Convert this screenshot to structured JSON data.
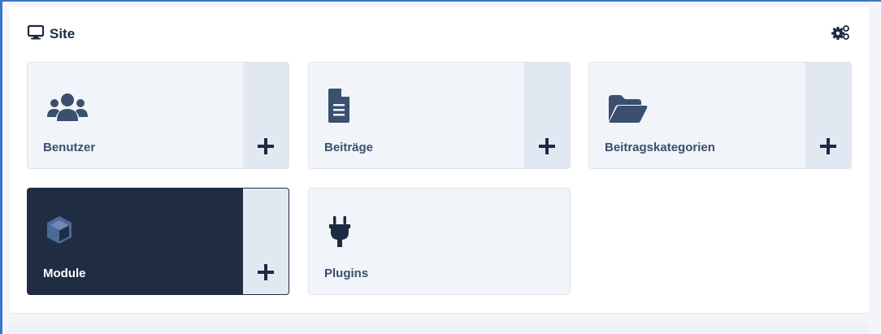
{
  "card": {
    "title": "Site",
    "title_icon": "monitor-icon",
    "settings_icon": "gears-icon"
  },
  "tiles": [
    {
      "label": "Benutzer",
      "icon": "users-icon",
      "has_add": true,
      "add_icon": "plus-icon",
      "active": false
    },
    {
      "label": "Beiträge",
      "icon": "document-icon",
      "has_add": true,
      "add_icon": "plus-icon",
      "active": false
    },
    {
      "label": "Beitragskategorien",
      "icon": "folder-open-icon",
      "has_add": true,
      "add_icon": "plus-icon",
      "active": false
    },
    {
      "label": "Module",
      "icon": "cube-icon",
      "has_add": true,
      "add_icon": "plus-icon",
      "active": true
    },
    {
      "label": "Plugins",
      "icon": "plug-icon",
      "has_add": false,
      "active": false
    }
  ],
  "colors": {
    "accent": "#3a76c7",
    "tile_bg": "#f1f4f9",
    "tile_add_bg": "#e1e8f2",
    "active_tile_bg": "#1f2c42",
    "icon": "#3b4f6e",
    "title": "#1c2a43"
  }
}
